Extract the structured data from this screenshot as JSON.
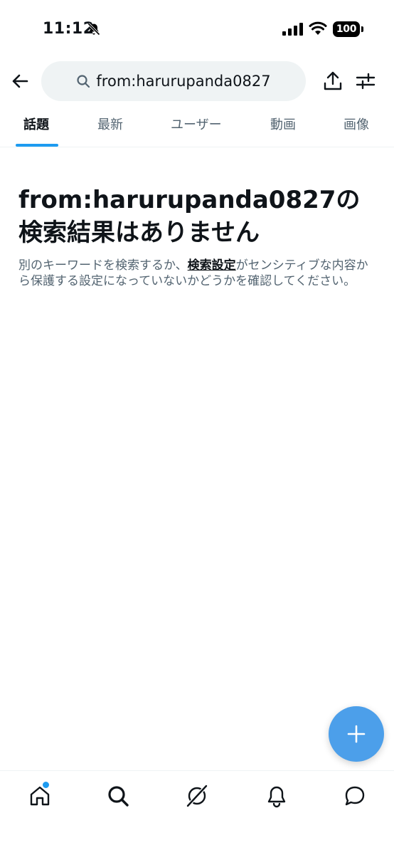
{
  "status_bar": {
    "time": "11:12",
    "battery": "100"
  },
  "search": {
    "query": "from:harurupanda0827"
  },
  "tabs": [
    {
      "label": "話題",
      "active": true
    },
    {
      "label": "最新",
      "active": false
    },
    {
      "label": "ユーザー",
      "active": false
    },
    {
      "label": "動画",
      "active": false
    },
    {
      "label": "画像",
      "active": false
    }
  ],
  "empty_state": {
    "title": "from:harurupanda0827の検索結果はありません",
    "desc_before": "別のキーワードを検索するか、",
    "settings_link": "検索設定",
    "desc_after": "がセンシティブな内容から保護する設定になっていないかどうかを確認してください。"
  },
  "bottom_nav": {
    "items": [
      "home",
      "search",
      "grok",
      "notifications",
      "messages"
    ],
    "home_has_dot": true
  },
  "colors": {
    "accent": "#1d9bf0",
    "fab": "#4c9fea",
    "text_primary": "#0f1419",
    "text_secondary": "#536471",
    "search_bg": "#eff3f4"
  },
  "icons": {
    "back": "arrow-left-icon",
    "search": "search-icon",
    "share": "share-icon",
    "filter": "sliders-icon",
    "fab": "plus-icon",
    "muted": "bell-off-icon"
  }
}
